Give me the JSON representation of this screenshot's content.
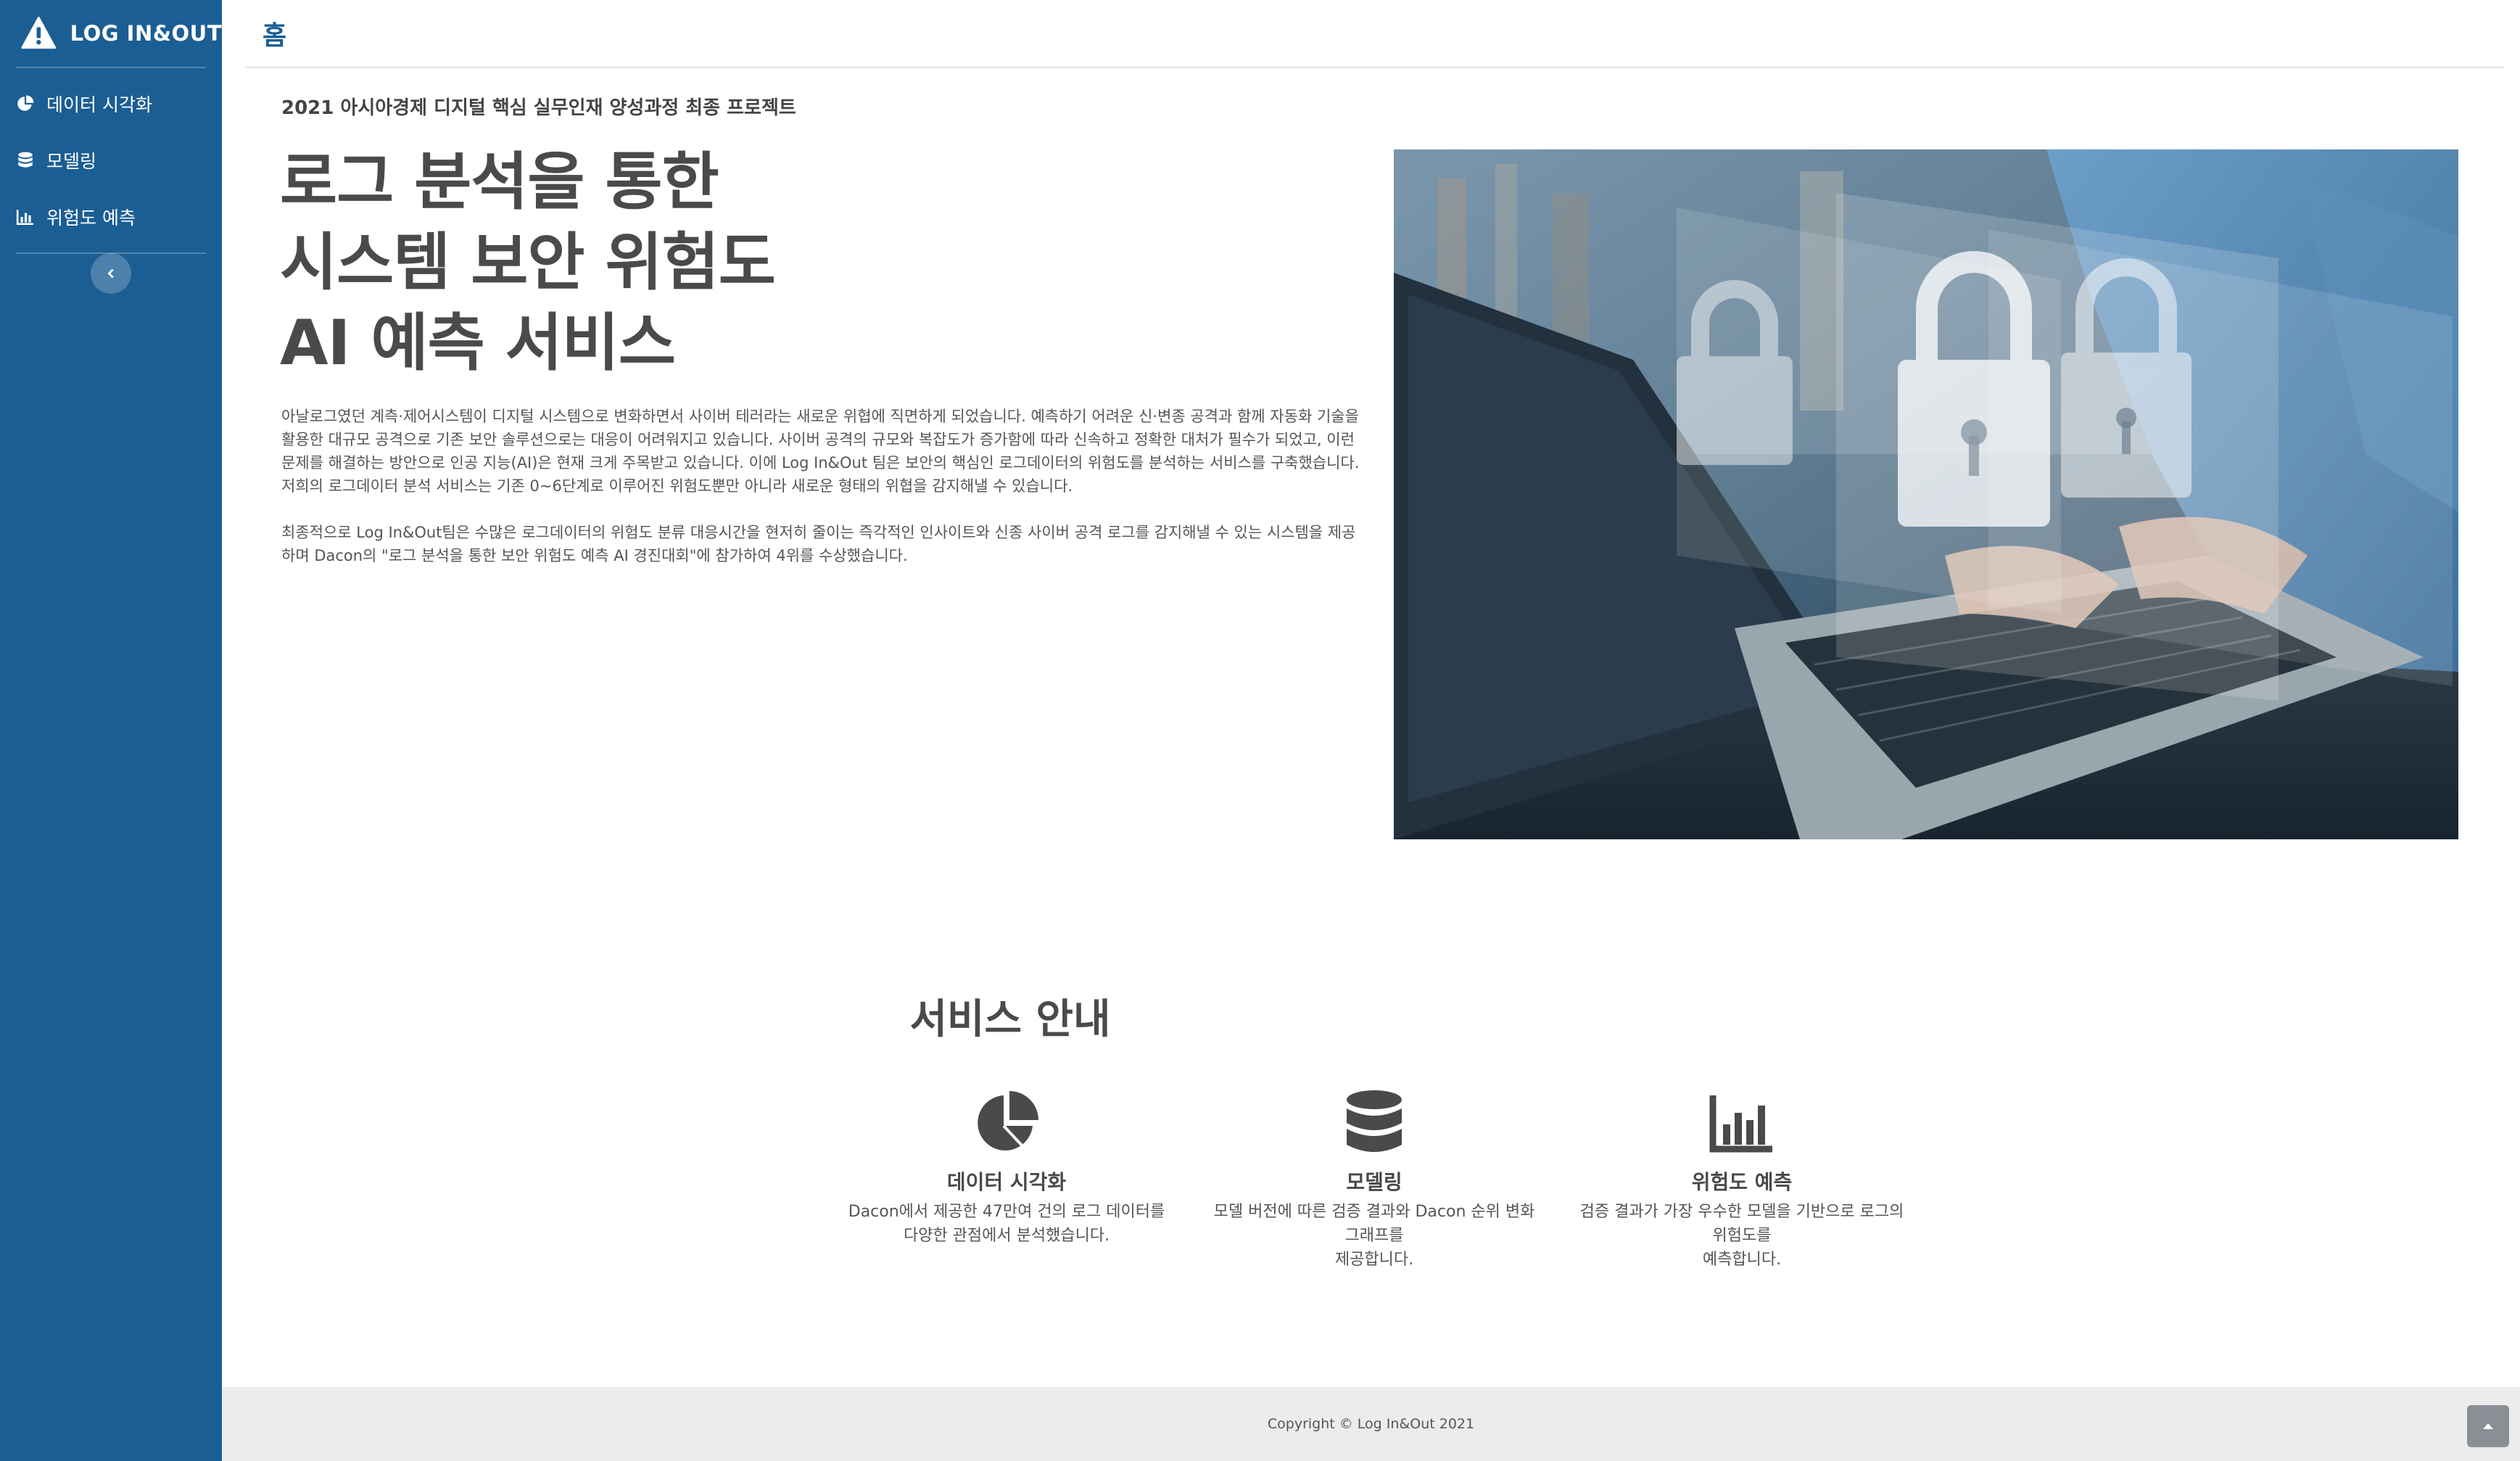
{
  "brand": {
    "name": "LOG IN&OUT"
  },
  "sidebar": {
    "items": [
      {
        "label": "데이터 시각화",
        "icon": "pie-chart-icon"
      },
      {
        "label": "모델링",
        "icon": "database-icon"
      },
      {
        "label": "위험도 예측",
        "icon": "bar-chart-icon"
      }
    ],
    "toggle_icon": "chevron-left-icon"
  },
  "header": {
    "title": "홈"
  },
  "hero": {
    "subtitle": "2021 아시아경제 디지털 핵심 실무인재 양성과정 최종 프로젝트",
    "headline": [
      "로그 분석을 통한",
      "시스템 보안 위험도",
      "AI 예측 서비스"
    ],
    "paragraph1": "아날로그였던 계측·제어시스템이 디지털 시스템으로 변화하면서 사이버 테러라는 새로운 위협에 직면하게 되었습니다. 예측하기 어려운 신·변종 공격과 함께 자동화 기술을 활용한 대규모 공격으로 기존 보안 솔루션으로는 대응이 어려워지고 있습니다. 사이버 공격의 규모와 복잡도가 증가함에 따라 신속하고 정확한 대처가 필수가 되었고, 이런 문제를 해결하는 방안으로 인공 지능(AI)은 현재 크게 주목받고 있습니다. 이에 Log In&Out 팀은 보안의 핵심인 로그데이터의 위험도를 분석하는 서비스를 구축했습니다. 저희의 로그데이터 분석 서비스는 기존 0~6단계로 이루어진 위험도뿐만 아니라 새로운 형태의 위협을 감지해낼 수 있습니다.",
    "paragraph2": "최종적으로 Log In&Out팀은 수많은 로그데이터의 위험도 분류 대응시간을 현저히 줄이는 즉각적인 인사이트와 신종 사이버 공격 로그를 감지해낼 수 있는 시스템을 제공하며 Dacon의 \"로그 분석을 통한 보안 위험도 예측 AI 경진대회\"에 참가하여 4위를 수상했습니다."
  },
  "services": {
    "title": "서비스 안내",
    "items": [
      {
        "name": "데이터 시각화",
        "icon": "pie-chart-icon",
        "desc": [
          "Dacon에서 제공한 47만여 건의 로그 데이터를",
          "다양한 관점에서 분석했습니다."
        ]
      },
      {
        "name": "모델링",
        "icon": "database-icon",
        "desc": [
          "모델 버전에 따른 검증 결과와 Dacon 순위 변화",
          "그래프를",
          "제공합니다."
        ]
      },
      {
        "name": "위험도 예측",
        "icon": "bar-chart-icon",
        "desc": [
          "검증 결과가 가장 우수한 모델을 기반으로 로그의",
          "위험도를",
          "예측합니다."
        ]
      }
    ]
  },
  "footer": {
    "copyright": "Copyright © Log In&Out 2021"
  },
  "colors": {
    "sidebar": "#1b5e94",
    "accent": "#1b5e94",
    "text": "#4a4a4a",
    "footer": "#ececec"
  }
}
